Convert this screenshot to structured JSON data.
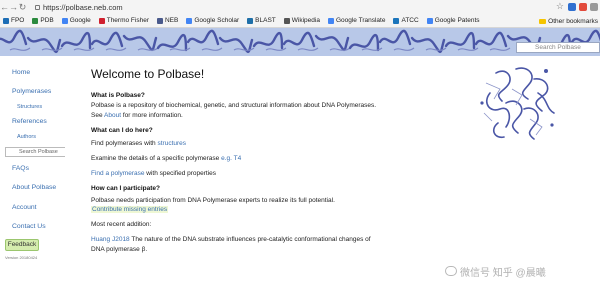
{
  "browser": {
    "url": "https://polbase.neb.com",
    "bookmarks": [
      {
        "label": "FPO",
        "color": "#1c6db5"
      },
      {
        "label": "PDB",
        "color": "#2b8a3e"
      },
      {
        "label": "Google",
        "color": "#4285f4"
      },
      {
        "label": "Thermo Fisher",
        "color": "#d0202e"
      },
      {
        "label": "NEB",
        "color": "#4a5a8c"
      },
      {
        "label": "Google Scholar",
        "color": "#4285f4"
      },
      {
        "label": "BLAST",
        "color": "#1e6fa8"
      },
      {
        "label": "Wikipedia",
        "color": "#555555"
      },
      {
        "label": "Google Translate",
        "color": "#4285f4"
      },
      {
        "label": "ATCC",
        "color": "#1b75bb"
      },
      {
        "label": "Google Patents",
        "color": "#4285f4"
      }
    ],
    "other_bookmarks": "Other bookmarks"
  },
  "banner": {
    "search_placeholder": "Search Polbase",
    "colors": {
      "background": "#b8c8e8",
      "protein": "#4a56a6"
    }
  },
  "sidebar": {
    "home": "Home",
    "polymerases": "Polymerases",
    "structures": "Structures",
    "references": "References",
    "authors": "Authors",
    "search_polbase": "Search Polbase",
    "faqs": "FAQs",
    "about": "About Polbase",
    "account": "Account",
    "contact": "Contact Us",
    "feedback": "Feedback",
    "version": "Version 20180424"
  },
  "main": {
    "title": "Welcome to Polbase!",
    "what_heading": "What is Polbase?",
    "what_text": "Polbase is a repository of biochemical, genetic, and structural information about DNA Polymerases.",
    "see": "See",
    "about_link": "About",
    "see_suffix": "for more information.",
    "can_heading": "What can I do here?",
    "find_prefix": "Find polymerases with",
    "structures_link": "structures",
    "examine_prefix": "Examine the details of a specific polymerase",
    "t4_link": "e.g. T4",
    "find_poly_link": "Find a polymerase",
    "find_poly_suffix": "with specified properties",
    "participate_heading": "How can I participate?",
    "participate_text": "Polbase needs participation from DNA Polymerase experts to realize its full potential.",
    "contribute_link": "Contribute missing entries",
    "recent_label": "Most recent addition:",
    "recent_link": "Huang J2018",
    "recent_text_1": "The nature of the DNA substrate influences pre-catalytic conformational changes of",
    "recent_text_2": "DNA polymerase β."
  },
  "watermark": {
    "text": "微信号 知乎 @晨曦"
  }
}
